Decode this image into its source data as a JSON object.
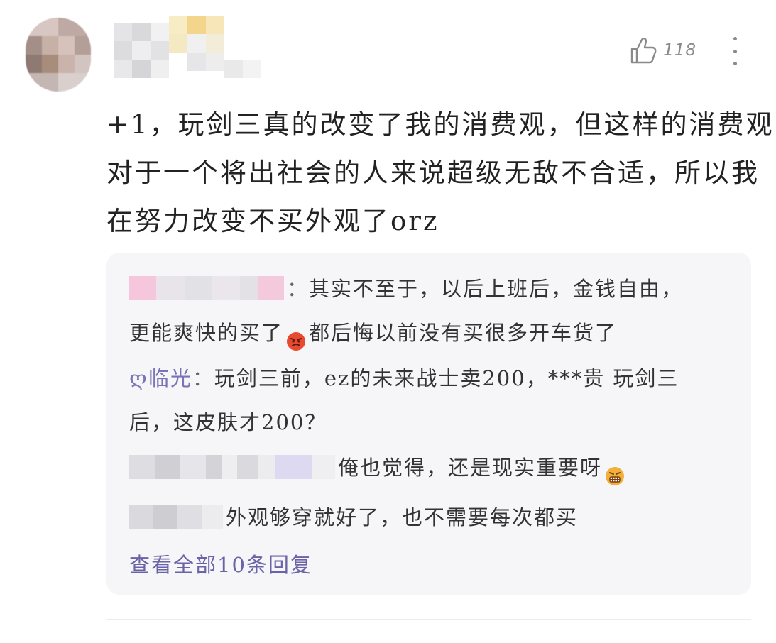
{
  "header": {
    "like_count": "118"
  },
  "comment": {
    "lines": [
      "+1，玩剑三真的改变了我的消费观，但这样的消费观",
      "对于一个将出社会的人来说超级无敌不合适，所以我",
      "在努力改变不买外观了orz"
    ]
  },
  "replies": [
    {
      "name": "",
      "colon": "：",
      "line1": "其实不至于，以后上班后，金钱自由，",
      "line2_before_emoji": "更能爽快的买了",
      "emoji": "angry-face",
      "line2_after_emoji": "都后悔以前没有买很多开车货了"
    },
    {
      "name": "ღ临光",
      "colon": "：",
      "line1": "玩剑三前，ez的未来战士卖200，***贵 玩剑三",
      "line2": "后，这皮肤才200？"
    },
    {
      "name": "",
      "text": "俺也觉得，还是现实重要呀",
      "emoji": "grimacing-face"
    },
    {
      "name": "",
      "text": "外观够穿就好了，也不需要每次都买"
    }
  ],
  "view_all_label": "查看全部10条回复",
  "colors": {
    "link": "#6b63a8",
    "reply_bg": "#f6f6f8",
    "text": "#222222",
    "meta": "#8a8a8a"
  }
}
